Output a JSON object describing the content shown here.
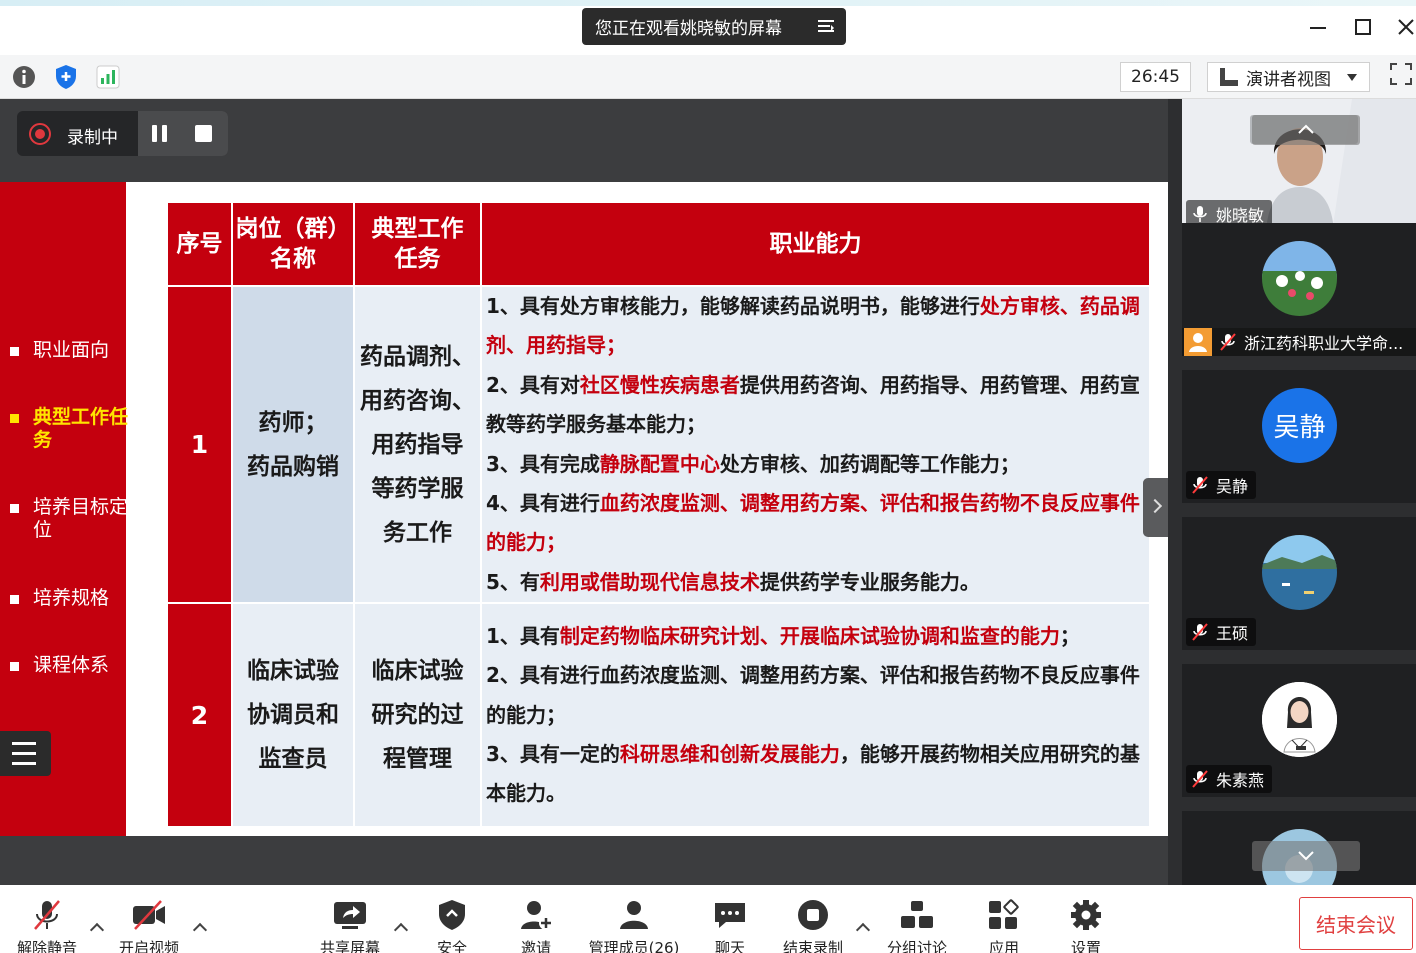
{
  "window": {
    "share_banner": "您正在观看姚晓敏的屏幕"
  },
  "toolbar": {
    "timer": "26:45",
    "view_mode": "演讲者视图"
  },
  "recording": {
    "label": "录制中"
  },
  "slide": {
    "sidebar": [
      {
        "label": "职业面向",
        "active": false
      },
      {
        "label": "典型工作任务",
        "active": true
      },
      {
        "label": "培养目标定位",
        "active": false
      },
      {
        "label": "培养规格",
        "active": false
      },
      {
        "label": "课程体系",
        "active": false
      }
    ],
    "table": {
      "headers": [
        "序号",
        "岗位（群）名称",
        "典型工作任务",
        "职业能力"
      ],
      "rows": [
        {
          "num": "1",
          "position_lines": [
            "药师；",
            "药品购销"
          ],
          "task_lines": [
            "药品调剂、",
            "用药咨询、",
            "用药指导",
            "等药学服",
            "务工作"
          ],
          "abilities": [
            [
              {
                "t": "1、具有处方审核能力，能够解读药品说明书，能够进行",
                "red": false
              },
              {
                "t": "处方审核、药品调剂、用药指导；",
                "red": true
              }
            ],
            [
              {
                "t": "2、具有对",
                "red": false
              },
              {
                "t": "社区慢性疾病患者",
                "red": true
              },
              {
                "t": "提供用药咨询、用药指导、用药管理、用药宣教等药学服务基本能力；",
                "red": false
              }
            ],
            [
              {
                "t": "3、具有完成",
                "red": false
              },
              {
                "t": "静脉配置中心",
                "red": true
              },
              {
                "t": "处方审核、加药调配等工作能力；",
                "red": false
              }
            ],
            [
              {
                "t": "4、具有进行",
                "red": false
              },
              {
                "t": "血药浓度监测、调整用药方案、评估和报告药物不良反应事件的能力；",
                "red": true
              }
            ],
            [
              {
                "t": "5、有",
                "red": false
              },
              {
                "t": "利用或借助现代信息技术",
                "red": true
              },
              {
                "t": "提供药学专业服务能力。",
                "red": false
              }
            ]
          ]
        },
        {
          "num": "2",
          "position_lines": [
            "临床试验",
            "协调员和",
            "监查员"
          ],
          "task_lines": [
            "临床试验",
            "研究的过",
            "程管理"
          ],
          "abilities": [
            [
              {
                "t": "1、具有",
                "red": false
              },
              {
                "t": "制定药物临床研究计划、开展临床试验协调和监查的能力",
                "red": true
              },
              {
                "t": "；",
                "red": false
              }
            ],
            [
              {
                "t": "2、具有进行血药浓度监测、调整用药方案、评估和报告药物不良反应事件的能力；",
                "red": false
              }
            ],
            [
              {
                "t": "3、具有一定的",
                "red": false
              },
              {
                "t": "科研思维和创新发展能力",
                "red": true
              },
              {
                "t": "，能够开展药物相关应用研究的基本能力。",
                "red": false
              }
            ]
          ]
        }
      ]
    }
  },
  "participants": [
    {
      "name": "姚晓敏",
      "type": "video",
      "mic": "on"
    },
    {
      "name": "浙江药科职业大学命...",
      "type": "avatar-landscape",
      "mic": "muted"
    },
    {
      "name": "吴静",
      "type": "initials",
      "initials": "吴静",
      "color": "#1a73e8",
      "mic": "muted"
    },
    {
      "name": "王硕",
      "type": "avatar-sea",
      "mic": "muted"
    },
    {
      "name": "朱素燕",
      "type": "avatar-doctor",
      "mic": "muted"
    }
  ],
  "bottombar": {
    "unmute": "解除静音",
    "video": "开启视频",
    "share": "共享屏幕",
    "security": "安全",
    "invite": "邀请",
    "members": "管理成员(26)",
    "chat": "聊天",
    "end_recording": "结束录制",
    "breakout": "分组讨论",
    "apps": "应用",
    "settings": "设置",
    "end_meeting": "结束会议"
  },
  "colors": {
    "slide_red": "#c4000e",
    "active_yellow": "#ffe400",
    "row_blue": "#cfdbe9",
    "row_light": "#e8eef5",
    "end_meeting": "#e04040"
  }
}
